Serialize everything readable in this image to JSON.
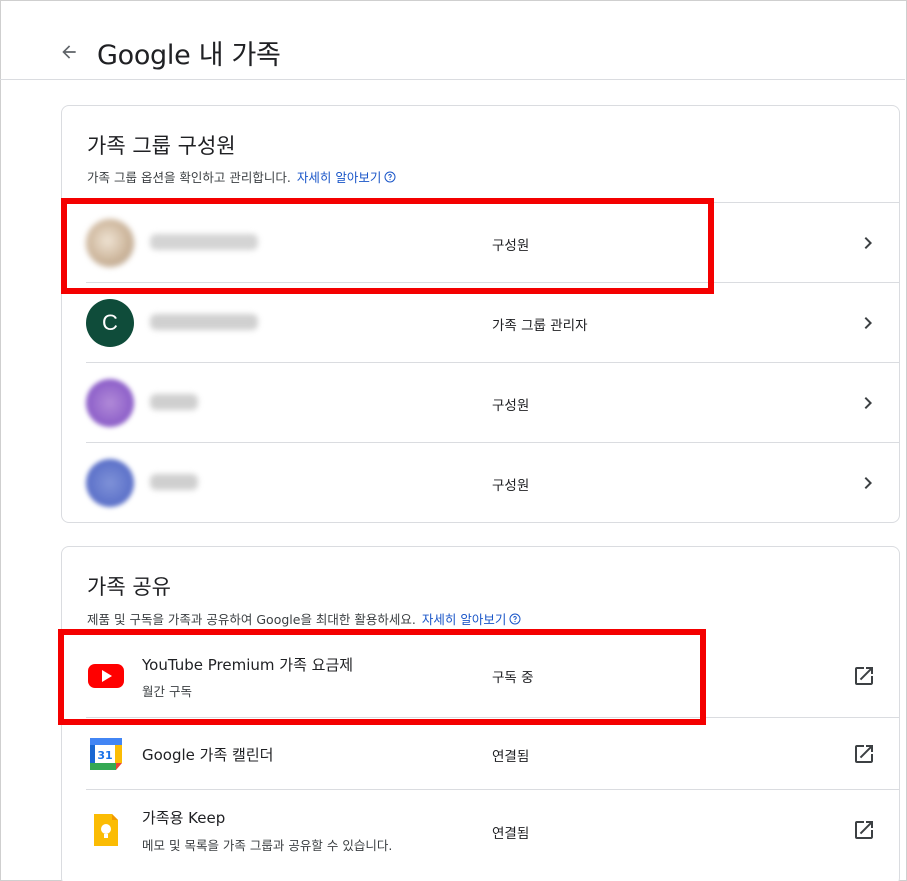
{
  "header": {
    "title": "Google 내 가족"
  },
  "members_card": {
    "title": "가족 그룹 구성원",
    "subtitle": "가족 그룹 옵션을 확인하고 관리합니다.",
    "learn_more": "자세히 알아보기",
    "members": [
      {
        "avatar": "blurred-photo",
        "role": "구성원"
      },
      {
        "avatar_letter": "C",
        "role": "가족 그룹 관리자"
      },
      {
        "avatar": "blurred-purple",
        "role": "구성원"
      },
      {
        "avatar": "blurred-blue",
        "role": "구성원"
      }
    ]
  },
  "sharing_card": {
    "title": "가족 공유",
    "subtitle": "제품 및 구독을 가족과 공유하여 Google을 최대한 활용하세요.",
    "learn_more": "자세히 알아보기",
    "services": [
      {
        "name": "YouTube Premium 가족 요금제",
        "sub": "월간 구독",
        "status": "구독 중",
        "icon": "youtube-icon"
      },
      {
        "name": "Google 가족 캘린더",
        "status": "연결됨",
        "icon": "calendar-icon",
        "calendar_day": "31"
      },
      {
        "name": "가족용 Keep",
        "sub": "메모 및 목록을 가족 그룹과 공유할 수 있습니다.",
        "status": "연결됨",
        "icon": "keep-icon"
      }
    ]
  },
  "colors": {
    "link": "#1a56c8",
    "highlight": "#f40000",
    "avatar_c": "#0f4c3a",
    "divider": "#dadce0"
  }
}
